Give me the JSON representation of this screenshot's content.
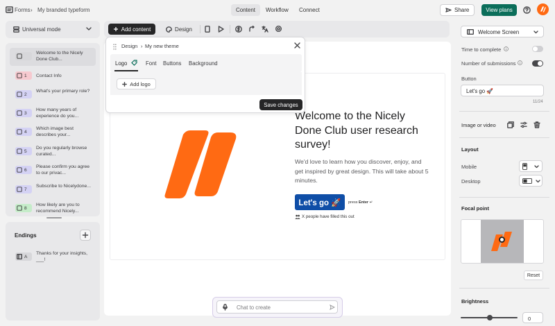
{
  "topbar": {
    "breadcrumb_root": "Forms",
    "breadcrumb_current": "My branded typeform",
    "tabs": [
      "Content",
      "Workflow",
      "Connect"
    ],
    "share_label": "Share",
    "view_plans_label": "View plans"
  },
  "sidebar": {
    "mode_label": "Universal mode",
    "questions": [
      {
        "num": "",
        "text": "Welcome to the Nicely Done Club...",
        "icon": "welcome-screen-icon",
        "color": "#d7d7da"
      },
      {
        "num": "1",
        "text": "Contact Info",
        "icon": "contact-icon",
        "color": "#f6c9cf"
      },
      {
        "num": "2",
        "text": "What's your primary role?",
        "icon": "list-icon",
        "color": "#d4d2f4"
      },
      {
        "num": "3",
        "text": "How many years of experience do you...",
        "icon": "dropdown-icon",
        "color": "#d4d2f4"
      },
      {
        "num": "4",
        "text": "Which image best describes your...",
        "icon": "image-choice-icon",
        "color": "#d4d2f4"
      },
      {
        "num": "5",
        "text": "Do you regularly browse curated...",
        "icon": "yes-no-icon",
        "color": "#d4d2f4"
      },
      {
        "num": "6",
        "text": "Please confirm you agree to our privac...",
        "icon": "legal-icon",
        "color": "#d4d2f4"
      },
      {
        "num": "7",
        "text": "Subscribe to Nicelydone...",
        "icon": "checkbox-icon",
        "color": "#d4d2f4"
      },
      {
        "num": "8",
        "text": "How likely are you to recommend Nicely...",
        "icon": "nps-icon",
        "color": "#c5ecc9"
      }
    ],
    "endings_label": "Endings",
    "endings": [
      {
        "num": "A",
        "text": "Thanks for your insights, ___!"
      }
    ]
  },
  "toolbar": {
    "add_content_label": "Add content",
    "design_label": "Design"
  },
  "theme_popup": {
    "breadcrumb_root": "Design",
    "breadcrumb_current": "My new theme",
    "tabs": [
      "Logo",
      "Font",
      "Buttons",
      "Background"
    ],
    "add_logo_label": "Add logo",
    "save_label": "Save changes"
  },
  "preview": {
    "heading": "Welcome to the Nicely Done Club user research survey!",
    "subtext": "We'd love to learn how you discover, enjoy, and get inspired by great design. This will take about 5 minutes.",
    "cta_label": "Let's go 🚀",
    "press_label": "press",
    "enter_label": "Enter",
    "enter_symbol": "↵",
    "social_proof": "X people have filled this out",
    "brand_color": "#ff6a13",
    "button_color": "#0f4ea7"
  },
  "chat": {
    "placeholder": "Chat to create"
  },
  "right_panel": {
    "screen_type": "Welcome Screen",
    "time_to_complete_label": "Time to complete",
    "time_to_complete_on": false,
    "submissions_label": "Number of submissions",
    "submissions_on": true,
    "button_label": "Button",
    "button_value": "Let's go 🚀",
    "char_count": "11/24",
    "image_video_label": "Image or video",
    "layout_label": "Layout",
    "mobile_label": "Mobile",
    "desktop_label": "Desktop",
    "focal_label": "Focal point",
    "reset_label": "Reset",
    "brightness_label": "Brightness",
    "brightness_value": "0"
  }
}
